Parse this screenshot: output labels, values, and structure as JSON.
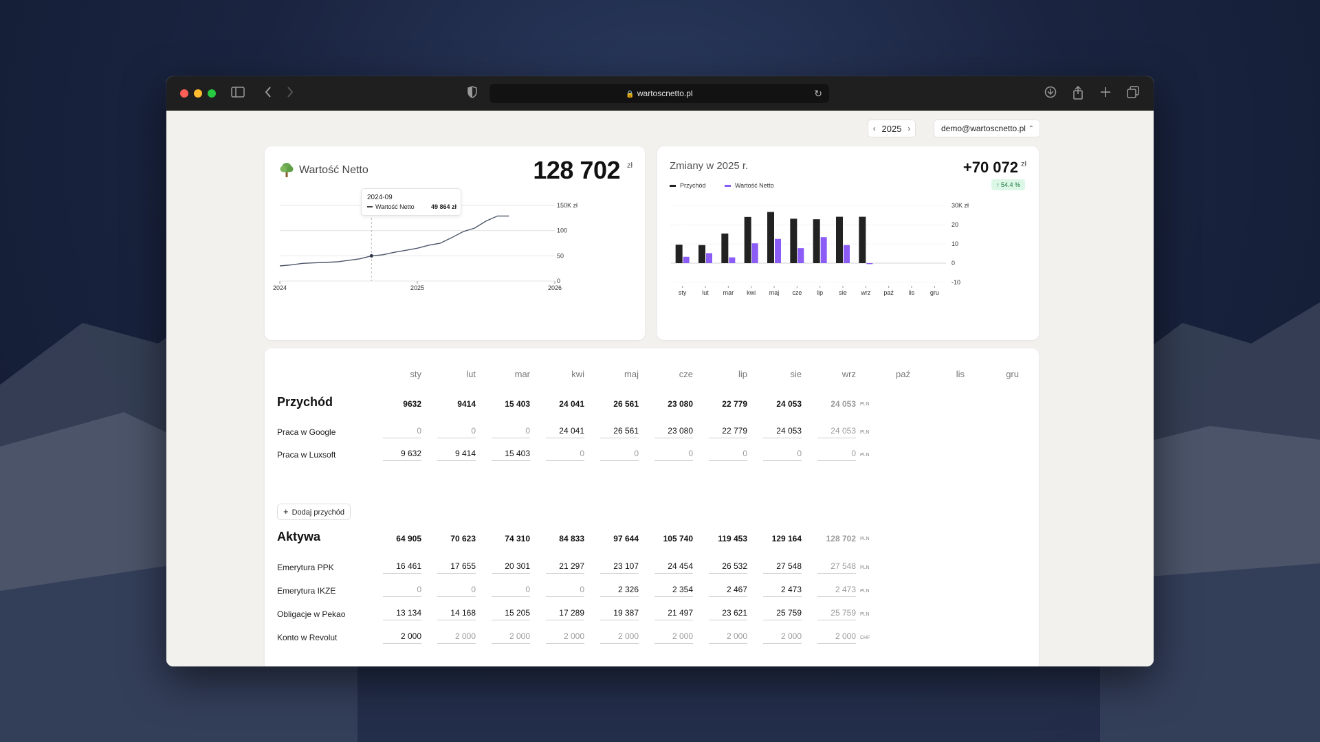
{
  "browser": {
    "url": "wartoscnetto.pl"
  },
  "header": {
    "year": "2025",
    "prev_icon": "‹",
    "next_icon": "›",
    "user": "demo@wartoscnetto.pl"
  },
  "networth": {
    "title": "Wartość Netto",
    "value": "128 702",
    "unit": "zł",
    "tooltip": {
      "date": "2024-09",
      "label": "Wartość Netto",
      "value": "49 864 zł"
    }
  },
  "changes": {
    "title": "Zmiany w 2025 r.",
    "value": "+70 072",
    "unit": "zł",
    "badge": "↑ 54.4 %",
    "legend": [
      {
        "name": "Przychód",
        "color": "#222222"
      },
      {
        "name": "Wartość Netto",
        "color": "#8b5cf6"
      }
    ]
  },
  "chart_data": [
    {
      "type": "line",
      "title": "",
      "x": [
        "2024-01",
        "2024-02",
        "2024-03",
        "2024-04",
        "2024-05",
        "2024-06",
        "2024-07",
        "2024-08",
        "2024-09",
        "2024-10",
        "2024-11",
        "2024-12",
        "2025-01",
        "2025-02",
        "2025-03",
        "2025-04",
        "2025-05",
        "2025-06",
        "2025-07",
        "2025-08",
        "2025-09"
      ],
      "series": [
        {
          "name": "Wartość Netto",
          "values": [
            30,
            32,
            35,
            36,
            37,
            38,
            41,
            44,
            49.864,
            52,
            57,
            61,
            65,
            71,
            75,
            86,
            98,
            105,
            119,
            129,
            129
          ]
        }
      ],
      "xticks": [
        "2024",
        "2025",
        "2026"
      ],
      "yticks": [
        "0",
        "50",
        "100",
        "150K zł"
      ],
      "ylim": [
        0,
        150
      ],
      "grid": true
    },
    {
      "type": "bar",
      "title": "",
      "categories": [
        "sty",
        "lut",
        "mar",
        "kwi",
        "maj",
        "cze",
        "lip",
        "sie",
        "wrz",
        "paź",
        "lis",
        "gru"
      ],
      "series": [
        {
          "name": "Przychód",
          "values": [
            9.6,
            9.4,
            15.4,
            24.0,
            26.6,
            23.1,
            22.8,
            24.1,
            24.1,
            null,
            null,
            null
          ]
        },
        {
          "name": "Wartość Netto",
          "values": [
            3.3,
            5.2,
            3.0,
            10.3,
            12.6,
            7.8,
            13.5,
            9.4,
            -0.5,
            null,
            null,
            null
          ]
        }
      ],
      "yticks": [
        "-10",
        "0",
        "10",
        "20",
        "30K zł"
      ],
      "ylim": [
        -10,
        30
      ],
      "grid": true
    }
  ],
  "table": {
    "months": [
      "sty",
      "lut",
      "mar",
      "kwi",
      "maj",
      "cze",
      "lip",
      "sie",
      "wrz",
      "paź",
      "lis",
      "gru"
    ],
    "income": {
      "title": "Przychód",
      "totals": [
        "9632",
        "9414",
        "15 403",
        "24 041",
        "26 561",
        "23 080",
        "22 779",
        "24 053",
        "24 053"
      ],
      "unit": "PLN",
      "rows": [
        {
          "label": "Praca w Google",
          "unit": "PLN",
          "values": [
            "0",
            "0",
            "0",
            "24 041",
            "26 561",
            "23 080",
            "22 779",
            "24 053",
            "24 053"
          ]
        },
        {
          "label": "Praca w Luxsoft",
          "unit": "PLN",
          "values": [
            "9 632",
            "9 414",
            "15 403",
            "0",
            "0",
            "0",
            "0",
            "0",
            "0"
          ]
        }
      ],
      "add_label": "Dodaj przychód"
    },
    "assets": {
      "title": "Aktywa",
      "totals": [
        "64 905",
        "70 623",
        "74 310",
        "84 833",
        "97 644",
        "105 740",
        "119 453",
        "129 164",
        "128 702"
      ],
      "unit": "PLN",
      "rows": [
        {
          "label": "Emerytura PPK",
          "unit": "PLN",
          "values": [
            "16 461",
            "17 655",
            "20 301",
            "21 297",
            "23 107",
            "24 454",
            "26 532",
            "27 548",
            "27 548"
          ]
        },
        {
          "label": "Emerytura IKZE",
          "unit": "PLN",
          "values": [
            "0",
            "0",
            "0",
            "0",
            "2 326",
            "2 354",
            "2 467",
            "2 473",
            "2 473"
          ]
        },
        {
          "label": "Obligacje w Pekao",
          "unit": "PLN",
          "values": [
            "13 134",
            "14 168",
            "15 205",
            "17 289",
            "19 387",
            "21 497",
            "23 621",
            "25 759",
            "25 759"
          ]
        },
        {
          "label": "Konto w Revolut",
          "unit": "CHF",
          "values": [
            "2 000",
            "2 000",
            "2 000",
            "2 000",
            "2 000",
            "2 000",
            "2 000",
            "2 000",
            "2 000"
          ]
        }
      ]
    }
  }
}
